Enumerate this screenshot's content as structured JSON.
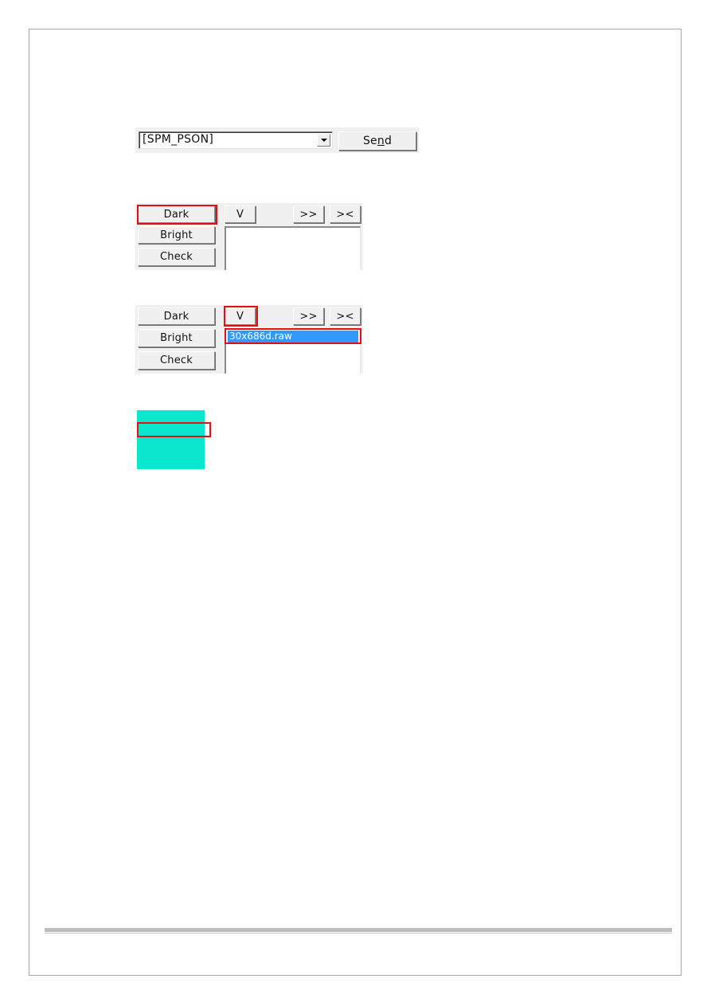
{
  "command_row": {
    "combo_value": "[SPM_PSON]",
    "send_label_pre": "Se",
    "send_label_mnemonic": "n",
    "send_label_post": "d"
  },
  "panel_1": {
    "buttons": [
      "Dark",
      "Bright",
      "Check"
    ],
    "toolbar": {
      "view_label": "V",
      "expand_label": ">>",
      "collapse_label": "><"
    },
    "list_items": [],
    "highlighted": "Dark"
  },
  "panel_2": {
    "buttons": [
      "Dark",
      "Bright",
      "Check"
    ],
    "toolbar": {
      "view_label": "V",
      "expand_label": ">>",
      "collapse_label": "><"
    },
    "list_items": [
      "30x686d.raw"
    ],
    "highlighted": [
      "V",
      "30x686d.raw"
    ]
  },
  "colors": {
    "highlight_border": "#e01010",
    "selection": "#3399ff",
    "preview_fill": "#0be6cf"
  }
}
